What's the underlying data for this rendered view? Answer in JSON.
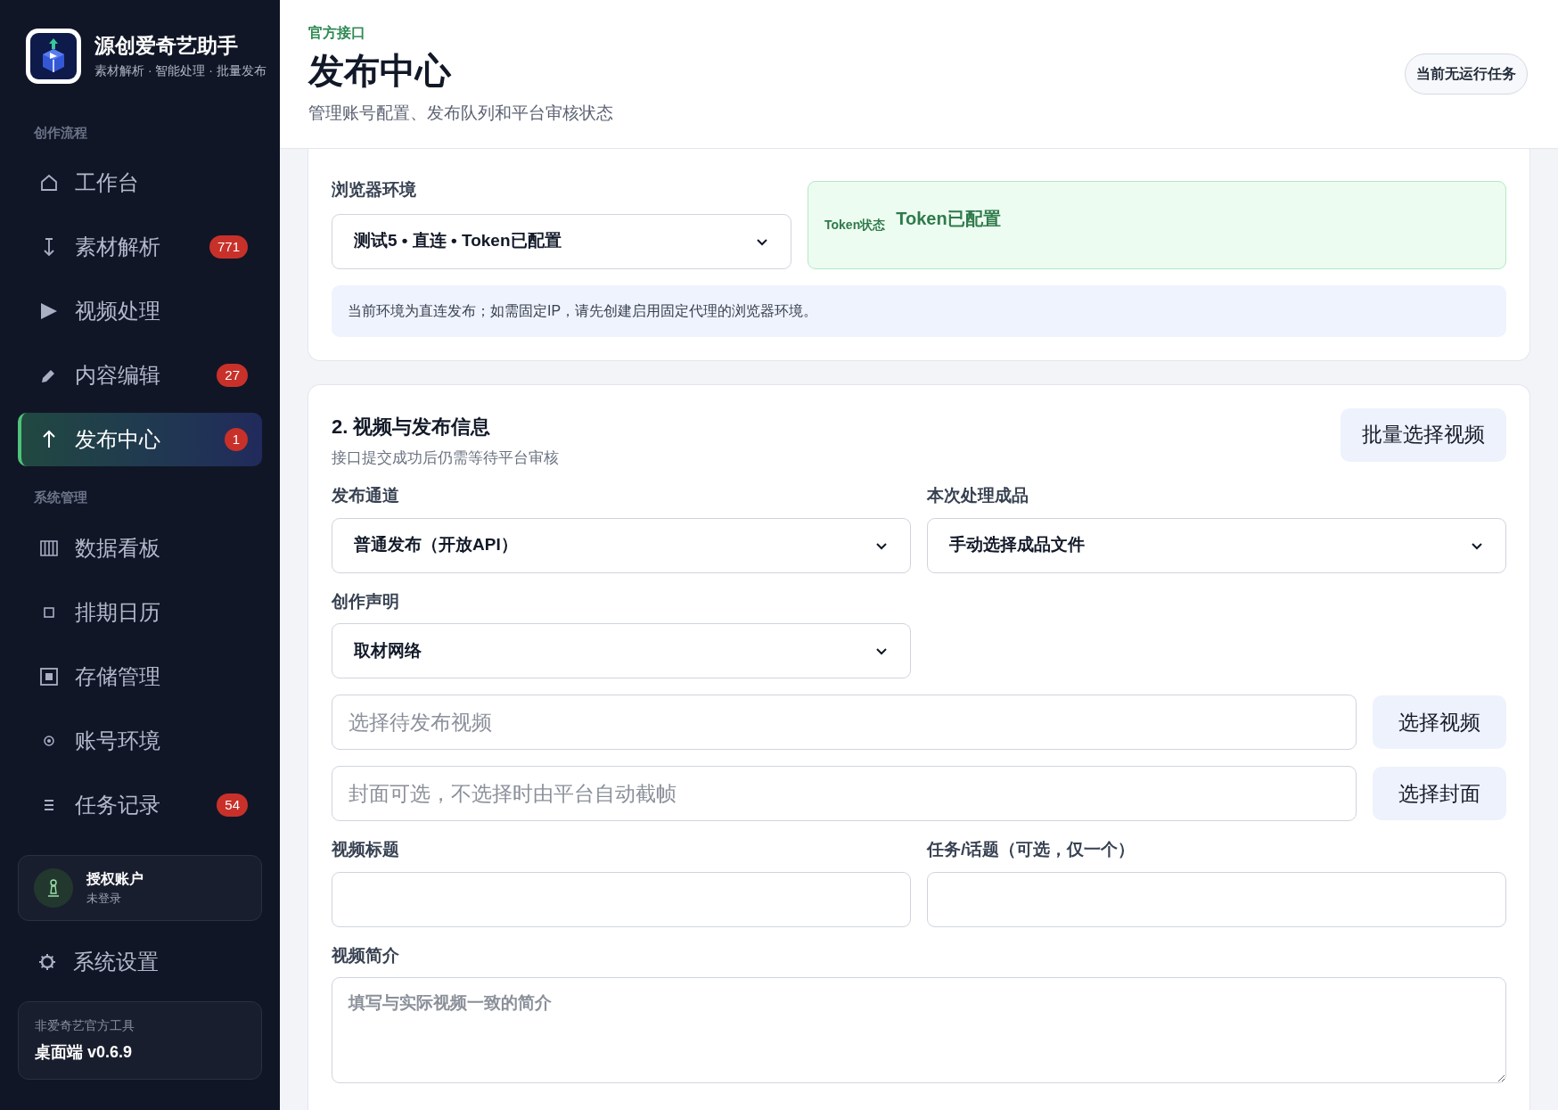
{
  "sidebar": {
    "brand": {
      "title": "源创爱奇艺助手",
      "subtitle": "素材解析 · 智能处理 · 批量发布"
    },
    "sections": [
      {
        "title": "创作流程",
        "items": [
          {
            "kind": "home",
            "label": "工作台",
            "selected": false
          },
          {
            "kind": "download",
            "label": "素材解析",
            "badge": "771",
            "selected": false
          },
          {
            "kind": "play",
            "label": "视频处理",
            "selected": false
          },
          {
            "kind": "pencil",
            "label": "内容编辑",
            "badge": "27",
            "selected": false
          },
          {
            "kind": "upload",
            "label": "发布中心",
            "badge": "1",
            "selected": true
          }
        ]
      },
      {
        "title": "系统管理",
        "items": [
          {
            "kind": "columns",
            "label": "数据看板",
            "selected": false
          },
          {
            "kind": "square",
            "label": "排期日历",
            "selected": false
          },
          {
            "kind": "box",
            "label": "存储管理",
            "selected": false
          },
          {
            "kind": "target",
            "label": "账号环境",
            "selected": false
          },
          {
            "kind": "list",
            "label": "任务记录",
            "badge": "54",
            "selected": false
          }
        ]
      }
    ],
    "account": {
      "title": "授权账户",
      "status": "未登录"
    },
    "settings": {
      "label": "系统设置"
    },
    "footer": {
      "note": "非爱奇艺官方工具",
      "version": "桌面端 v0.6.9"
    }
  },
  "header": {
    "tag": "官方接口",
    "title": "发布中心",
    "subtitle": "管理账号配置、发布队列和平台审核状态",
    "status_button": "当前无运行任务"
  },
  "env_card": {
    "field_label": "浏览器环境",
    "select_value": "测试5 • 直连 • Token已配置",
    "token_label": "Token状态",
    "token_value": "Token已配置",
    "notice": "当前环境为直连发布；如需固定IP，请先创建启用固定代理的浏览器环境。"
  },
  "publish_card": {
    "title": "2. 视频与发布信息",
    "subtitle": "接口提交成功后仍需等待平台审核",
    "batch_button": "批量选择视频",
    "fields": [
      {
        "kind": "select",
        "label": "发布通道",
        "value": "普通发布（开放API）"
      },
      {
        "kind": "select",
        "label": "本次处理成品",
        "value": "手动选择成品文件"
      },
      {
        "kind": "select",
        "label": "创作声明",
        "value": "取材网络"
      },
      {
        "kind": "file",
        "placeholder": "选择待发布视频",
        "button": "选择视频"
      },
      {
        "kind": "file",
        "placeholder": "封面可选，不选择时由平台自动截帧",
        "button": "选择封面"
      },
      {
        "kind": "text",
        "label": "视频标题"
      },
      {
        "kind": "text",
        "label": "任务/话题（可选，仅一个）"
      },
      {
        "kind": "textarea",
        "label": "视频简介",
        "placeholder": "填写与实际视频一致的简介"
      }
    ]
  }
}
